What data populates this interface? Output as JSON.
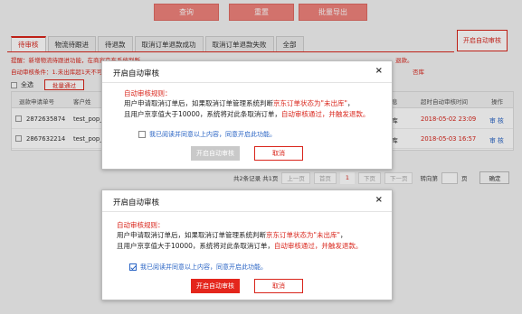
{
  "top_buttons": {
    "query": "查询",
    "reset": "重置",
    "export": "批量导出"
  },
  "tabs": [
    "待审核",
    "物流待跟进",
    "待退款",
    "取消订单退款成功",
    "取消订单退款失败",
    "全部"
  ],
  "auto_review_button": "开启自动审核",
  "notice": "提醒：新增物流待跟进功能，在商家京东系统判断",
  "notice_tail": "退款。",
  "auto_condition": "自动审核条件：1.未出库超1天不可",
  "auto_condition_tail": "否库",
  "select_all": "全选",
  "batch_pass": "批量通过",
  "table": {
    "headers": [
      "退款申请单号",
      "客户姓",
      "息",
      "超时自动审核时间",
      "操作"
    ],
    "rows": [
      {
        "id": "2872635874",
        "customer": "test_pop_",
        "status": "库",
        "time": "2018-05-02 23:09",
        "action": "审 核"
      },
      {
        "id": "2867632214",
        "customer": "test_pop_",
        "status": "库",
        "time": "2018-05-03 16:57",
        "action": "审 核"
      }
    ]
  },
  "pager": {
    "summary": "共2条记录 共1页",
    "first": "首页",
    "prev": "上一页",
    "current": "1",
    "next": "下页",
    "last": "下一页",
    "goto": "转向第",
    "page_unit": "页",
    "confirm": "确定"
  },
  "dialog1": {
    "title": "开启自动审核",
    "close": "×",
    "rule_title": "自动审核规则：",
    "line1_a": "用户申请取消订单后，如果取消订单管理系统判断",
    "line1_b": "京东订单状态为\"未出库\"",
    "line1_c": "，",
    "line2_a": "且用户京享值大于10000，系统将对此条取消订单，",
    "line2_b": "自动审核通过，并触发退款。",
    "agree": "我已阅读并同意以上内容，同意开启此功能。",
    "agree_checked": false,
    "confirm": "开启自动审核",
    "cancel": "取消"
  },
  "dialog2": {
    "title": "开启自动审核",
    "close": "×",
    "rule_title": "自动审核规则：",
    "line1_a": "用户申请取消订单后，如果取消订单管理系统判断",
    "line1_b": "京东订单状态为\"未出库\"",
    "line1_c": "，",
    "line2_a": "且用户京享值大于10000，系统将对此条取消订单，",
    "line2_b": "自动审核通过，并触发退款。",
    "agree": "我已阅读并同意以上内容，同意开启此功能。",
    "agree_checked": true,
    "confirm": "开启自动审核",
    "cancel": "取消"
  }
}
